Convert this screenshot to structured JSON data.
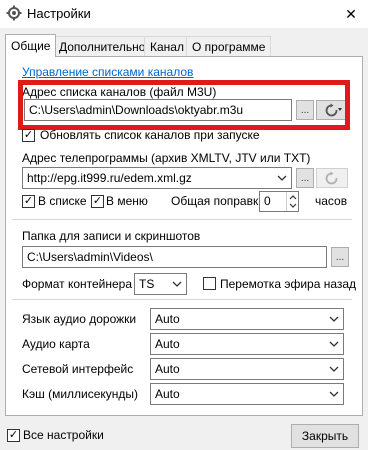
{
  "window": {
    "title": "Настройки",
    "close_glyph": "✕"
  },
  "tabs": [
    "Общие",
    "Дополнительно",
    "Канал",
    "О программе"
  ],
  "channel_list_link": "Управление списками каналов",
  "playlist": {
    "label": "Адрес списка каналов (файл M3U)",
    "value": "C:\\Users\\admin\\Downloads\\oktyabr.m3u",
    "update_on_start_label": "Обновлять список каналов при запуске",
    "update_on_start_checked": true
  },
  "epg": {
    "label": "Адрес телепрограммы (архив XMLTV, JTV или TXT)",
    "value": "http://epg.it999.ru/edem.xml.gz",
    "in_list_label": "В списке",
    "in_list_checked": true,
    "in_menu_label": "В меню",
    "in_menu_checked": true,
    "offset_label": "Общая поправка",
    "offset_value": "0",
    "offset_unit": "часов"
  },
  "record": {
    "folder_label": "Папка для записи и скриншотов",
    "folder_value": "C:\\Users\\admin\\Videos\\",
    "container_label": "Формат контейнера",
    "container_value": "TS",
    "timeshift_label": "Перемотка эфира назад",
    "timeshift_checked": false
  },
  "audio": {
    "track_label": "Язык аудио дорожки",
    "track_value": "Auto",
    "card_label": "Аудио карта",
    "card_value": "Auto",
    "network_label": "Сетевой интерфейс",
    "network_value": "Auto",
    "cache_label": "Кэш (миллисекунды)",
    "cache_value": "Auto"
  },
  "footer": {
    "all_settings_label": "Все настройки",
    "all_settings_checked": true,
    "close_label": "Закрыть"
  },
  "browse_glyph": "...",
  "check_glyph": "✓",
  "colors": {
    "highlight": "#e01a1a",
    "link": "#0066cc"
  }
}
